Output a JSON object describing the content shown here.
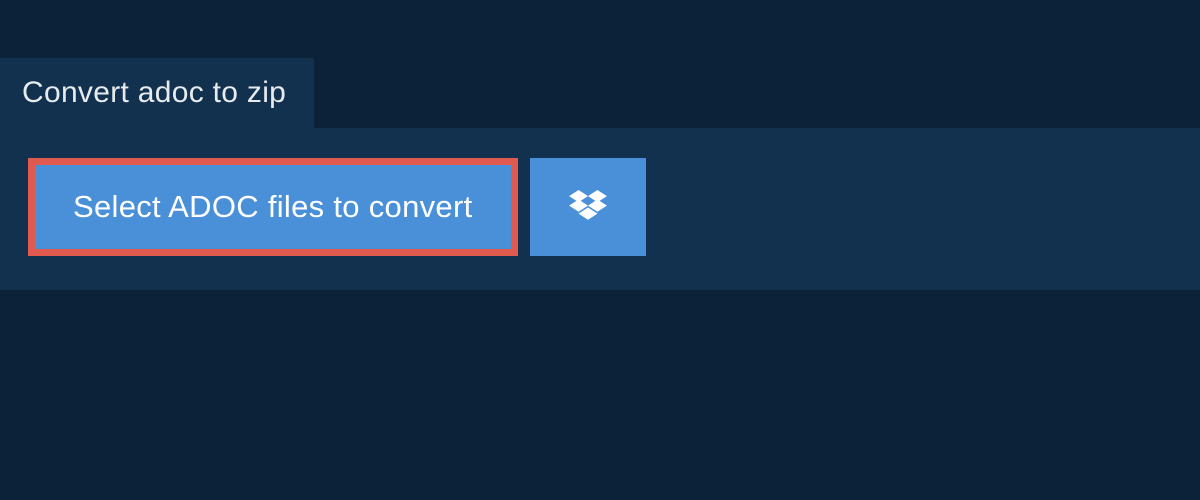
{
  "header": {
    "title": "Convert adoc to zip"
  },
  "actions": {
    "select_label": "Select ADOC files to convert",
    "dropbox_icon": "dropbox-icon"
  },
  "colors": {
    "background": "#0c2238",
    "panel": "#12314f",
    "button": "#4a90d9",
    "highlight_border": "#e05a4f",
    "text_light": "#e8ebed",
    "text_white": "#ffffff"
  }
}
